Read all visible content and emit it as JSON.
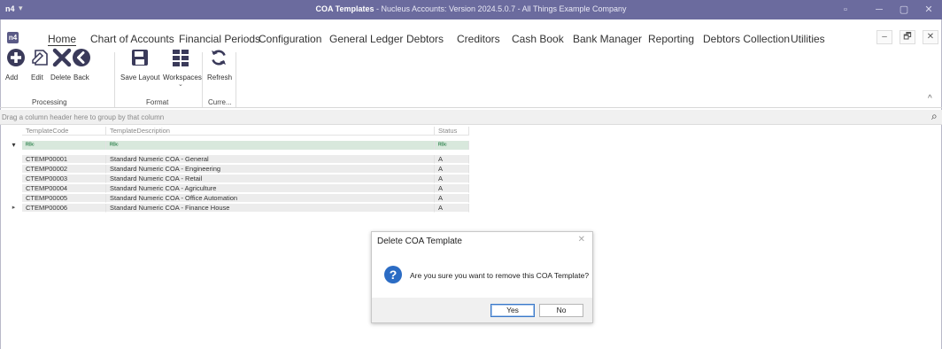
{
  "titlebar": {
    "app_icon": "n4",
    "title_bold": "COA Templates",
    "title_rest": " - Nucleus Accounts: Version 2024.5.0.7 - All Things Example Company",
    "buttons": [
      "▫",
      "─",
      "▢",
      "✕"
    ]
  },
  "menu": {
    "ribbon_icon": "n4",
    "items": [
      "Home",
      "Chart of Accounts",
      "Financial Periods",
      "Configuration",
      "General Ledger",
      "Debtors",
      "Creditors",
      "Cash Book",
      "Bank Manager",
      "Reporting",
      "Debtors Collection",
      "Utilities"
    ],
    "mdi_buttons": [
      "–",
      "🗗",
      "✕"
    ]
  },
  "ribbon": {
    "buttons": {
      "add": "Add",
      "edit": "Edit",
      "delete": "Delete",
      "back": "Back",
      "save_layout": "Save Layout",
      "workspaces": "Workspaces",
      "refresh": "Refresh"
    },
    "groups": {
      "processing": "Processing",
      "format": "Format",
      "current": "Curre..."
    },
    "collapse_glyph": "^"
  },
  "groupbar": {
    "hint": "Drag a column header here to group by that column",
    "search_glyph": "⌕"
  },
  "grid": {
    "columns": [
      "TemplateCode",
      "TemplateDescription",
      "Status"
    ],
    "filter_glyph": "▾",
    "filter_cell": "ᴿᴮᶜ",
    "rows": [
      {
        "code": "CTEMP00001",
        "description": "Standard Numeric COA - General",
        "status": "A"
      },
      {
        "code": "CTEMP00002",
        "description": "Standard Numeric COA - Engineering",
        "status": "A"
      },
      {
        "code": "CTEMP00003",
        "description": "Standard Numeric COA - Retail",
        "status": "A"
      },
      {
        "code": "CTEMP00004",
        "description": "Standard Numeric COA - Agriculture",
        "status": "A"
      },
      {
        "code": "CTEMP00005",
        "description": "Standard Numeric COA - Office Automation",
        "status": "A"
      },
      {
        "code": "CTEMP00006",
        "description": "Standard Numeric COA - Finance House",
        "status": "A"
      }
    ],
    "current_row_marker": "▸"
  },
  "dialog": {
    "title": "Delete COA Template",
    "close": "✕",
    "icon": "?",
    "message": "Are you sure you want to remove this COA Template?",
    "yes": "Yes",
    "no": "No"
  }
}
